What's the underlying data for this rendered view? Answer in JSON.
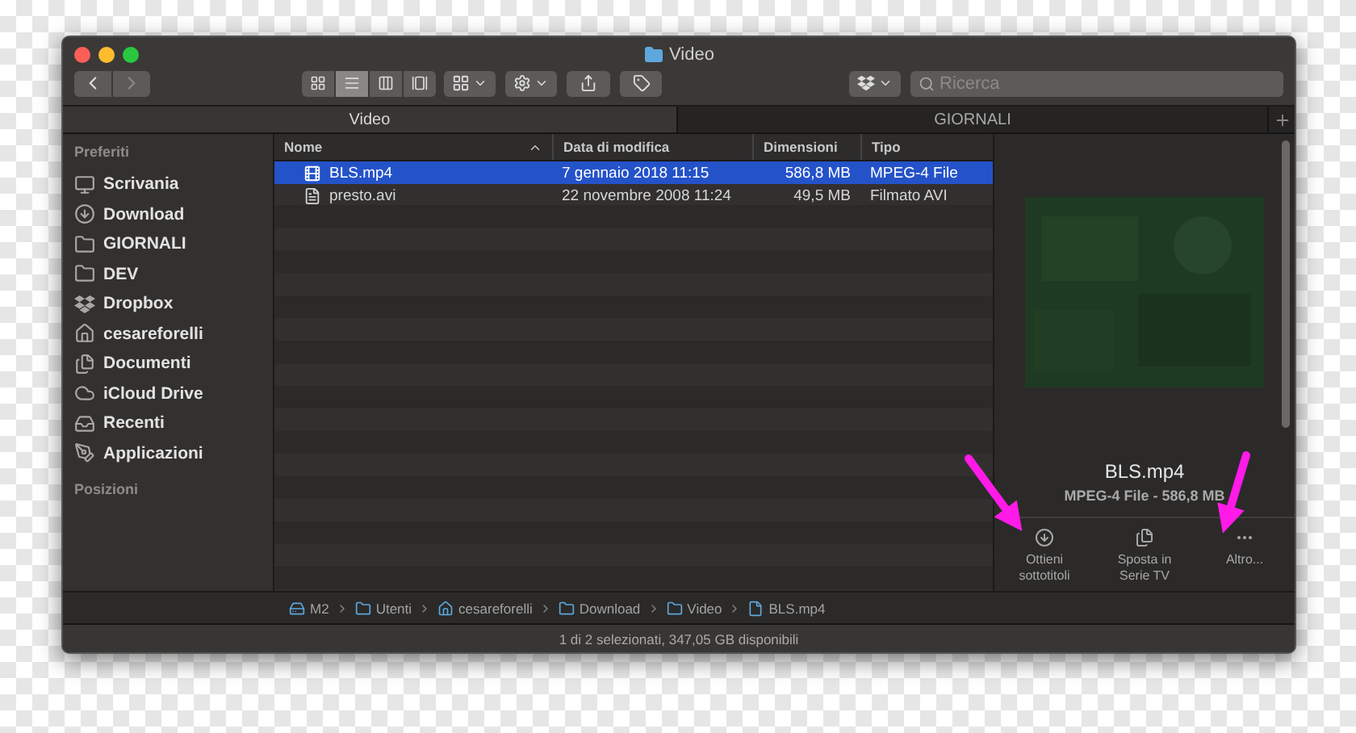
{
  "window": {
    "title": "Video"
  },
  "toolbar": {
    "view_buttons": [
      {
        "kind": "icons",
        "selected": false
      },
      {
        "kind": "list",
        "selected": true
      },
      {
        "kind": "columns",
        "selected": false
      },
      {
        "kind": "gallery",
        "selected": false
      }
    ]
  },
  "search": {
    "placeholder": "Ricerca"
  },
  "tabs": [
    {
      "label": "Video",
      "selected": true
    },
    {
      "label": "GIORNALI",
      "selected": false
    }
  ],
  "sidebar": {
    "sections": [
      {
        "title": "Preferiti",
        "items": [
          {
            "label": "Scrivania",
            "kind": "desktop"
          },
          {
            "label": "Download",
            "kind": "download"
          },
          {
            "label": "GIORNALI",
            "kind": "folder"
          },
          {
            "label": "DEV",
            "kind": "folder"
          },
          {
            "label": "Dropbox",
            "kind": "dropbox"
          },
          {
            "label": "cesareforelli",
            "kind": "home"
          },
          {
            "label": "Documenti",
            "kind": "documents"
          },
          {
            "label": "iCloud Drive",
            "kind": "cloud"
          },
          {
            "label": "Recenti",
            "kind": "recents"
          },
          {
            "label": "Applicazioni",
            "kind": "apps"
          }
        ]
      },
      {
        "title": "Posizioni"
      }
    ]
  },
  "table": {
    "columns": [
      {
        "label": "Nome",
        "sorted": true
      },
      {
        "label": "Data di modifica",
        "sorted": false
      },
      {
        "label": "Dimensioni",
        "sorted": false
      },
      {
        "label": "Tipo",
        "sorted": false
      }
    ],
    "rows": [
      {
        "name": "BLS.mp4",
        "kind": "video",
        "date": "7 gennaio 2018 11:15",
        "size": "586,8 MB",
        "type": "MPEG-4 File",
        "selected": true
      },
      {
        "name": "presto.avi",
        "kind": "document",
        "date": "22 novembre 2008 11:24",
        "size": "49,5 MB",
        "type": "Filmato AVI",
        "selected": false
      }
    ]
  },
  "preview": {
    "name": "BLS.mp4",
    "info": "MPEG-4 File - 586,8 MB",
    "actions": [
      {
        "label": "Ottieni sottotitoli",
        "kind": "download"
      },
      {
        "label": "Sposta in Serie TV",
        "kind": "move"
      },
      {
        "label": "Altro...",
        "kind": "more"
      }
    ]
  },
  "path_bar": [
    {
      "label": "M2",
      "kind": "disk"
    },
    {
      "label": "Utenti",
      "kind": "folder"
    },
    {
      "label": "cesareforelli",
      "kind": "home"
    },
    {
      "label": "Download",
      "kind": "folder"
    },
    {
      "label": "Video",
      "kind": "folder"
    },
    {
      "label": "BLS.mp4",
      "kind": "file"
    }
  ],
  "status_bar": "1 di 2 selezionati, 347,05 GB disponibili"
}
